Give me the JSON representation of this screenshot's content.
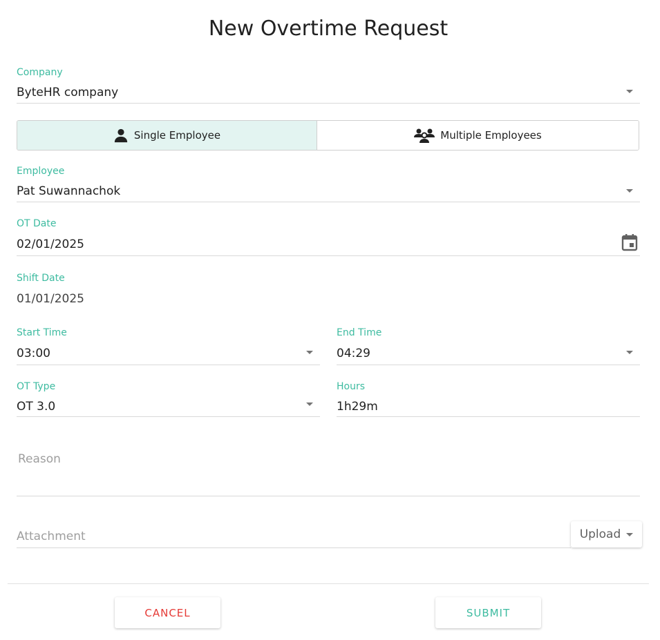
{
  "page": {
    "title": "New Overtime Request"
  },
  "company": {
    "label": "Company",
    "value": "ByteHR company"
  },
  "mode_toggle": {
    "single_label": "Single Employee",
    "multiple_label": "Multiple Employees",
    "selected": "single"
  },
  "employee": {
    "label": "Employee",
    "value": "Pat Suwannachok"
  },
  "ot_date": {
    "label": "OT Date",
    "value": "02/01/2025"
  },
  "shift_date": {
    "label": "Shift Date",
    "value": "01/01/2025"
  },
  "start_time": {
    "label": "Start Time",
    "value": "03:00"
  },
  "end_time": {
    "label": "End Time",
    "value": "04:29"
  },
  "ot_type": {
    "label": "OT Type",
    "value": "OT 3.0"
  },
  "hours": {
    "label": "Hours",
    "value": "1h29m"
  },
  "reason": {
    "placeholder": "Reason"
  },
  "attachment": {
    "placeholder": "Attachment",
    "upload_label": "Upload"
  },
  "actions": {
    "cancel_label": "CANCEL",
    "submit_label": "SUBMIT"
  },
  "colors": {
    "accent": "#3dbba0",
    "danger": "#e53935",
    "selected_bg": "#e3f4f1"
  },
  "icons": {
    "single": "person-icon",
    "multiple": "group-icon",
    "calendar": "calendar-icon",
    "dropdown": "caret-down-icon"
  }
}
